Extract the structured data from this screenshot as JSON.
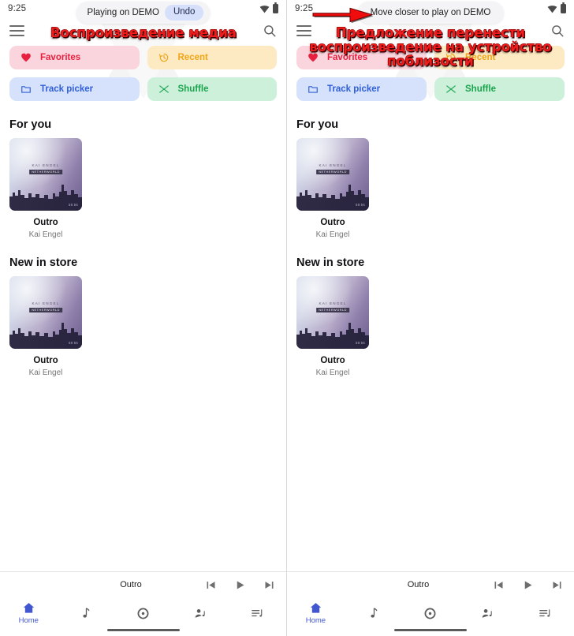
{
  "meta": {
    "panels": 2
  },
  "status": {
    "time": "9:25",
    "wifi_icon": "wifi-icon",
    "battery_icon": "battery-icon"
  },
  "appbar": {
    "menu_icon": "hamburger-menu-icon",
    "search_icon": "search-icon"
  },
  "left_panel": {
    "snackbar": {
      "message": "Playing on DEMO",
      "action_label": "Undo"
    },
    "annotation": "Воспроизведение медиа"
  },
  "right_panel": {
    "snackbar": {
      "message": "Move closer to play on DEMO"
    },
    "annotation_lines": [
      "Предложение перенести",
      "воспроизведение на устройство",
      "поблизости"
    ],
    "arrow_icon": "red-arrow-right-icon"
  },
  "chips": [
    {
      "label": "Favorites",
      "icon": "heart-icon",
      "color": "#e8203f",
      "bg": "#fbd5dd"
    },
    {
      "label": "Recent",
      "icon": "history-icon",
      "color": "#f0a517",
      "bg": "#fdeac2"
    },
    {
      "label": "Track picker",
      "icon": "folder-icon",
      "color": "#2f5fd8",
      "bg": "#d6e2fb"
    },
    {
      "label": "Shuffle",
      "icon": "shuffle-icon",
      "color": "#1aa44e",
      "bg": "#cdf0da"
    }
  ],
  "sections": [
    {
      "title": "For you",
      "card": {
        "title": "Outro",
        "artist": "Kai Engel",
        "art_artist_text": "KAI ENGEL",
        "art_album_text": "NETHERWORLD",
        "art_badge_text": "59:56"
      }
    },
    {
      "title": "New in store",
      "card": {
        "title": "Outro",
        "artist": "Kai Engel",
        "art_artist_text": "KAI ENGEL",
        "art_album_text": "NETHERWORLD",
        "art_badge_text": "59:56"
      }
    }
  ],
  "miniplayer": {
    "track_title": "Outro",
    "previous_icon": "skip-previous-icon",
    "play_icon": "play-icon",
    "next_icon": "skip-next-icon"
  },
  "navbar": {
    "items": [
      {
        "label": "Home",
        "icon": "home-icon",
        "selected": true
      },
      {
        "label": "",
        "icon": "music-note-icon",
        "selected": false
      },
      {
        "label": "",
        "icon": "album-disc-icon",
        "selected": false
      },
      {
        "label": "",
        "icon": "artist-icon",
        "selected": false
      },
      {
        "label": "",
        "icon": "playlist-icon",
        "selected": false
      }
    ],
    "accent_color": "#4256d0"
  }
}
